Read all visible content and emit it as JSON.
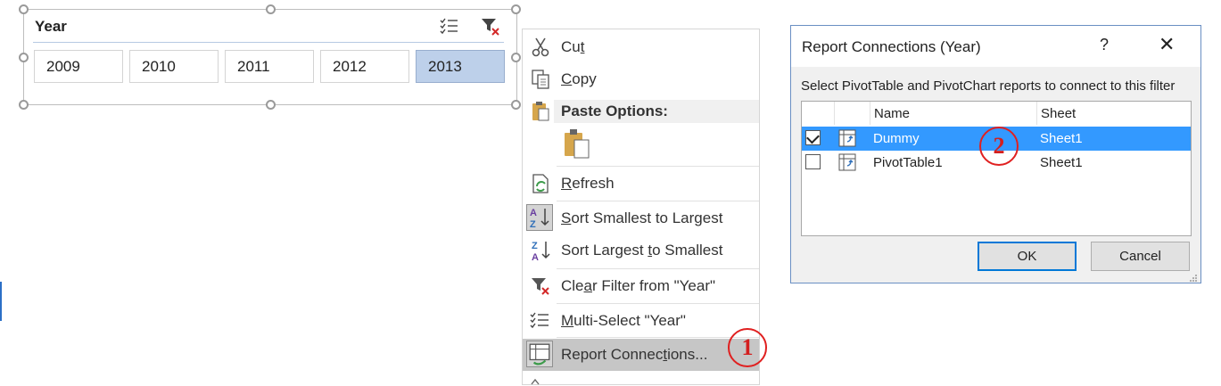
{
  "slicer": {
    "title": "Year",
    "items": [
      {
        "label": "2009",
        "selected": false
      },
      {
        "label": "2010",
        "selected": false
      },
      {
        "label": "2011",
        "selected": false
      },
      {
        "label": "2012",
        "selected": false
      },
      {
        "label": "2013",
        "selected": true
      }
    ],
    "icons": [
      "multi-select-icon",
      "clear-filter-icon"
    ]
  },
  "context_menu": {
    "items": {
      "cut": {
        "before": "Cu",
        "key": "t",
        "after": ""
      },
      "copy": {
        "before": "",
        "key": "C",
        "after": "opy"
      },
      "paste_header": "Paste Options:",
      "refresh": {
        "before": "",
        "key": "R",
        "after": "efresh"
      },
      "sort_asc": {
        "before": "",
        "key": "S",
        "after": "ort Smallest to Largest"
      },
      "sort_desc": {
        "before": "Sort Largest ",
        "key": "t",
        "after": "o Smallest"
      },
      "clear_filter": {
        "before": "Cle",
        "key": "a",
        "after": "r Filter from \"Year\""
      },
      "multi_select": {
        "before": "",
        "key": "M",
        "after": "ulti-Select \"Year\""
      },
      "report_connections": {
        "before": "Report Connec",
        "key": "t",
        "after": "ions..."
      }
    },
    "highlighted": "report_connections"
  },
  "dialog": {
    "title": "Report Connections (Year)",
    "help": "?",
    "close": "✕",
    "instruction": "Select PivotTable and PivotChart reports to connect to this filter",
    "columns": {
      "name": "Name",
      "sheet": "Sheet"
    },
    "rows": [
      {
        "checked": true,
        "name": "Dummy",
        "sheet": "Sheet1",
        "selected": true
      },
      {
        "checked": false,
        "name": "PivotTable1",
        "sheet": "Sheet1",
        "selected": false
      }
    ],
    "ok_label": "OK",
    "cancel_label": "Cancel"
  },
  "annotations": {
    "step1": "1",
    "step2": "2"
  },
  "colors": {
    "slicer_selected": "#bdd0ea",
    "row_selected": "#3399ff",
    "annotation_red": "#e02020",
    "menu_highlight": "#c6c6c6",
    "dialog_border": "#6a8fc3"
  }
}
